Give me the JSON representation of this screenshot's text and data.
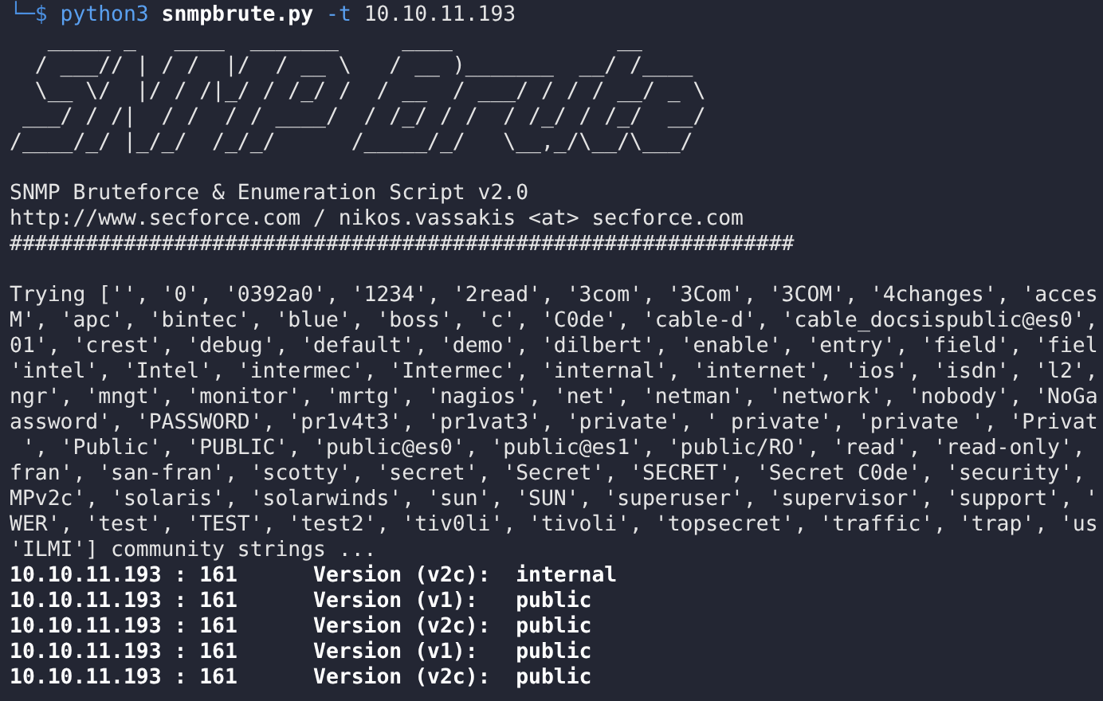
{
  "prompt": {
    "prefix": "└─$",
    "command": "python3",
    "script": "snmpbrute.py",
    "flag": "-t",
    "target": "10.10.11.193"
  },
  "banner_art": [
    "   _____ _   ____  _______     ____             __",
    "  / ___// | / /  |/  / __ \\   / __ )_______  __/ /____",
    "  \\__ \\/  |/ / /|_/ / /_/ /  / __  / ___/ / / / __/ _ \\",
    " ___/ / /|  / /  / / ____/  / /_/ / /  / /_/ / /_/  __/",
    "/____/_/ |_/_/  /_/_/      /_____/_/   \\__,_/\\__/\\___/"
  ],
  "header": [
    "SNMP Bruteforce & Enumeration Script v2.0",
    "http://www.secforce.com / nikos.vassakis <at> secforce.com",
    "##############################################################"
  ],
  "output_lines": [
    "Trying ['', '0', '0392a0', '1234', '2read', '3com', '3Com', '3COM', '4changes', 'acces",
    "M', 'apc', 'bintec', 'blue', 'boss', 'c', 'C0de', 'cable-d', 'cable_docsispublic@es0',",
    "01', 'crest', 'debug', 'default', 'demo', 'dilbert', 'enable', 'entry', 'field', 'fiel",
    "'intel', 'Intel', 'intermec', 'Intermec', 'internal', 'internet', 'ios', 'isdn', 'l2',",
    "ngr', 'mngt', 'monitor', 'mrtg', 'nagios', 'net', 'netman', 'network', 'nobody', 'NoGa",
    "assword', 'PASSWORD', 'pr1v4t3', 'pr1vat3', 'private', ' private', 'private ', 'Privat",
    " ', 'Public', 'PUBLIC', 'public@es0', 'public@es1', 'public/RO', 'read', 'read-only',",
    "fran', 'san-fran', 'scotty', 'secret', 'Secret', 'SECRET', 'Secret C0de', 'security',",
    "MPv2c', 'solaris', 'solarwinds', 'sun', 'SUN', 'superuser', 'supervisor', 'support', '",
    "WER', 'test', 'TEST', 'test2', 'tiv0li', 'tivoli', 'topsecret', 'traffic', 'trap', 'us",
    "'ILMI'] community strings ..."
  ],
  "results": [
    {
      "host": "10.10.11.193 : 161",
      "version": "Version (v2c):",
      "community": "internal"
    },
    {
      "host": "10.10.11.193 : 161",
      "version": "Version (v1):",
      "community": "public"
    },
    {
      "host": "10.10.11.193 : 161",
      "version": "Version (v2c):",
      "community": "public"
    },
    {
      "host": "10.10.11.193 : 161",
      "version": "Version (v1):",
      "community": "public"
    },
    {
      "host": "10.10.11.193 : 161",
      "version": "Version (v2c):",
      "community": "public"
    }
  ]
}
